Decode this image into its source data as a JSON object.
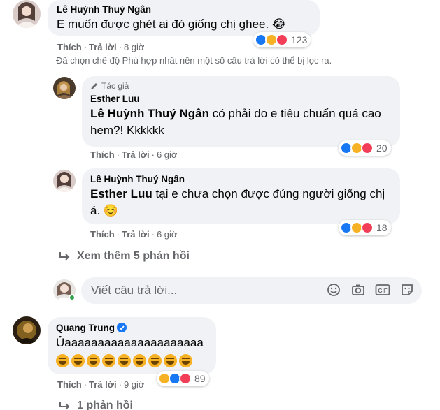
{
  "comments": [
    {
      "author": "Lê Huỳnh Thuý Ngân",
      "text": "E muốn được ghét ai đó giống chị ghee. 😂",
      "like_label": "Thích",
      "reply_label": "Trả lời",
      "time": "8 giờ",
      "reaction_count": "123"
    }
  ],
  "filter_notice": "Đã chọn chế độ Phù hợp nhất nên một số câu trả lời có thể bị lọc ra.",
  "replies": [
    {
      "badge": "Tác giả",
      "author": "Esther Luu",
      "mention": "Lê Huỳnh Thuý Ngân",
      "text": " có phải do e tiêu chuẩn quá cao hem?! Kkkkkk",
      "like_label": "Thích",
      "reply_label": "Trả lời",
      "time": "6 giờ",
      "reaction_count": "20"
    },
    {
      "author": "Lê Huỳnh Thuý Ngân",
      "mention": "Esther Luu",
      "text": " tại e chưa chọn được đúng người giống chị á. ☺️",
      "like_label": "Thích",
      "reply_label": "Trả lời",
      "time": "6 giờ",
      "reaction_count": "18"
    }
  ],
  "view_more": "Xem thêm 5 phản hồi",
  "reply_input": {
    "placeholder": "Viết câu trả lời..."
  },
  "comment2": {
    "author": "Quang Trung",
    "text": "Ủaaaaaaaaaaaaaaaaaaaaa",
    "emoji_count": 9,
    "like_label": "Thích",
    "reply_label": "Trả lời",
    "time": "9 giờ",
    "reaction_count": "89"
  },
  "replies_count_label": "1 phản hồi",
  "colors": {
    "accent": "#1877f2",
    "bubble": "#f0f2f5",
    "meta": "#65676b",
    "online": "#31a24c"
  }
}
